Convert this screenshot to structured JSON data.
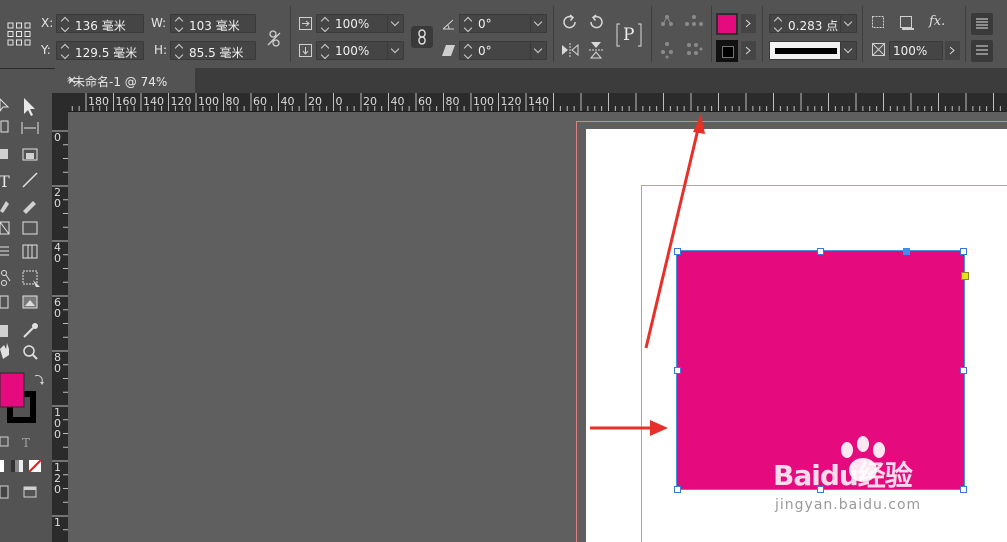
{
  "control_panel": {
    "x_label": "X:",
    "x_value": "136 毫米",
    "y_label": "Y:",
    "y_value": "129.5 毫米",
    "w_label": "W:",
    "w_value": "103 毫米",
    "h_label": "H:",
    "h_value": "85.5 毫米",
    "scale_x": "100%",
    "scale_y": "100%",
    "rotate_angle": "0°",
    "shear_angle": "0°",
    "text_frame_glyph": "P",
    "stroke_weight": "0.283 点",
    "opacity": "100%",
    "fx_label": "fx.",
    "fill_color": "#e50a7d",
    "stroke_color": "#000000"
  },
  "tab": {
    "title": "*未命名-1 @ 74%",
    "close": "×"
  },
  "h_ruler_labels": [
    "180",
    "160",
    "140",
    "120",
    "100",
    "80",
    "60",
    "40",
    "20",
    "0",
    "20",
    "40",
    "60",
    "80",
    "100",
    "120",
    "140"
  ],
  "v_ruler_labels": [
    [
      "0"
    ],
    [
      "2",
      "0"
    ],
    [
      "4",
      "0"
    ],
    [
      "6",
      "0"
    ],
    [
      "8",
      "0"
    ],
    [
      "1",
      "0",
      "0"
    ],
    [
      "1",
      "2",
      "0"
    ],
    [
      "1"
    ]
  ],
  "toolbox": {
    "type_tool_glyph": "T",
    "format_text_glyph": "T"
  },
  "document": {
    "rectangle_fill": "#e50a7d",
    "watermark_main": "Baidu经验",
    "watermark_sub": "jingyan.baidu.com"
  },
  "colors": {
    "panel_bg": "#535353",
    "ruler_bg": "#2b2b2b",
    "pasteboard": "#5f5f5f",
    "annotation_arrow": "#e8302a"
  }
}
